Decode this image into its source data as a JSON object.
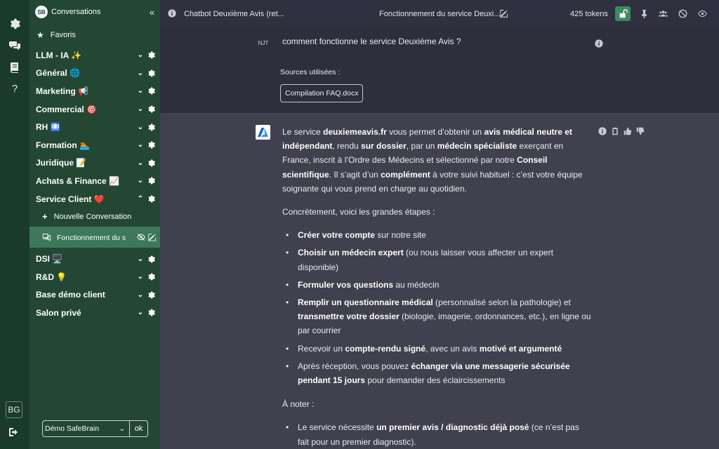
{
  "sidebar": {
    "header": "Conversations",
    "favorites": "Favoris",
    "categories": [
      "LLM - IA ✨",
      "Général 🌐",
      "Marketing 📢",
      "Commercial 🎯",
      "RH 🛄",
      "Formation 🏊",
      "Juridique 📝",
      "Achats & Finance 📈",
      "Service Client ❤️"
    ],
    "new_conversation": "Nouvelle Conversation",
    "active_conversation": "Fonctionnement du s📌",
    "categories_after": [
      "DSI 🖥️",
      "R&D 💡",
      "Base démo client",
      "Salon privé"
    ],
    "workspace": "Démo SafeBrain",
    "ok": "ok"
  },
  "rail": {
    "user_initials": "BG"
  },
  "topbar": {
    "title": "Chatbot Deuxième Avis (ret...",
    "conversation_title": "Fonctionnement du service Deuxi...",
    "tokens": "425 tokens"
  },
  "question": {
    "avatar": "NJT",
    "text": "comment fonctionne le service Deuxième Avis ?",
    "sources_label": "Sources utilisées :",
    "source_file": "Compilation FAQ.docx"
  },
  "answer": {
    "p1": [
      {
        "t": "Le service "
      },
      {
        "t": "deuxiemeavis.fr",
        "b": true
      },
      {
        "t": " vous permet d’obtenir un "
      },
      {
        "t": "avis médical neutre et indépendant",
        "b": true
      },
      {
        "t": ", rendu "
      },
      {
        "t": "sur dossier",
        "b": true
      },
      {
        "t": ", par un "
      },
      {
        "t": "médecin spécialiste",
        "b": true
      },
      {
        "t": " exerçant en France, inscrit à l’Ordre des Médecins et sélectionné par notre "
      },
      {
        "t": "Conseil scientifique",
        "b": true
      },
      {
        "t": ". Il s’agit d’un "
      },
      {
        "t": "complément",
        "b": true
      },
      {
        "t": " à votre suivi habituel : c’est votre équipe soignante qui vous prend en charge au quotidien."
      }
    ],
    "p2": "Concrètement, voici les grandes étapes :",
    "steps": [
      [
        {
          "t": "Créer votre compte",
          "b": true
        },
        {
          "t": " sur notre site"
        }
      ],
      [
        {
          "t": "Choisir un médecin expert",
          "b": true
        },
        {
          "t": " (ou nous laisser vous affecter un expert disponible)"
        }
      ],
      [
        {
          "t": "Formuler vos questions",
          "b": true
        },
        {
          "t": " au médecin"
        }
      ],
      [
        {
          "t": "Remplir un questionnaire médical",
          "b": true
        },
        {
          "t": " (personnalisé selon la pathologie) et "
        },
        {
          "t": "transmettre votre dossier",
          "b": true
        },
        {
          "t": " (biologie, imagerie, ordonnances, etc.), en ligne ou par courrier"
        }
      ],
      [
        {
          "t": "Recevoir un "
        },
        {
          "t": "compte-rendu signé",
          "b": true
        },
        {
          "t": ", avec un avis "
        },
        {
          "t": "motivé et argumenté",
          "b": true
        }
      ],
      [
        {
          "t": "Après réception, vous pouvez "
        },
        {
          "t": "échanger via une messagerie sécurisée pendant 15 jours",
          "b": true
        },
        {
          "t": " pour demander des éclaircissements"
        }
      ]
    ],
    "p3": "À noter :",
    "notes": [
      [
        {
          "t": "Le service nécessite "
        },
        {
          "t": "un premier avis / diagnostic déjà posé",
          "b": true
        },
        {
          "t": " (ce n’est pas fait pour un premier diagnostic)."
        }
      ]
    ]
  }
}
